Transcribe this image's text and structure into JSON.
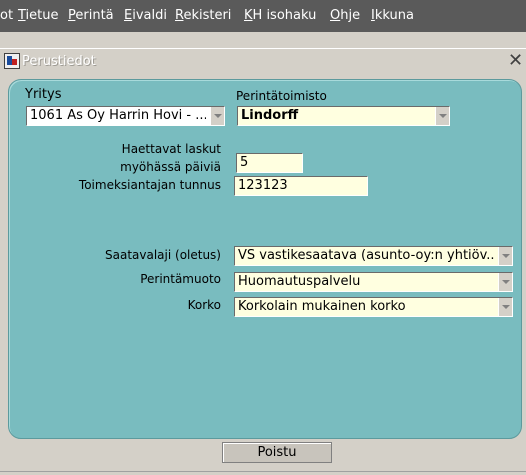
{
  "menu": [
    {
      "prefix": "",
      "accel": "",
      "rest": "ot"
    },
    {
      "prefix": "",
      "accel": "T",
      "rest": "ietue"
    },
    {
      "prefix": "",
      "accel": "P",
      "rest": "erintä"
    },
    {
      "prefix": "",
      "accel": "E",
      "rest": "ivaldi"
    },
    {
      "prefix": "",
      "accel": "R",
      "rest": "ekisteri"
    },
    {
      "prefix": "",
      "accel": "K",
      "rest": "H isohaku"
    },
    {
      "prefix": "",
      "accel": "O",
      "rest": "hje"
    },
    {
      "prefix": "",
      "accel": "I",
      "rest": "kkuna"
    }
  ],
  "window": {
    "title": "Perustiedot"
  },
  "form": {
    "yritys": {
      "label": "Yritys",
      "value": "1061 As Oy Harrin Hovi - ..."
    },
    "perintatoimisto": {
      "label": "Perintätoimisto",
      "value": "Lindorff"
    },
    "haettavat": {
      "label_line1": "Haettavat laskut",
      "label_line2": "myöhässä päiviä",
      "value": "5"
    },
    "toimeksiantaja": {
      "label": "Toimeksiantajan tunnus",
      "value": "123123"
    },
    "saatavalaji": {
      "label": "Saatavalaji (oletus)",
      "value": "VS vastikesaatava (asunto-oy:n yhtiöv..."
    },
    "perintamuoto": {
      "label": "Perintämuoto",
      "value": "Huomautuspalvelu"
    },
    "korko": {
      "label": "Korko",
      "value": "Korkolain mukainen korko"
    }
  },
  "buttons": {
    "poistu": "Poistu"
  }
}
